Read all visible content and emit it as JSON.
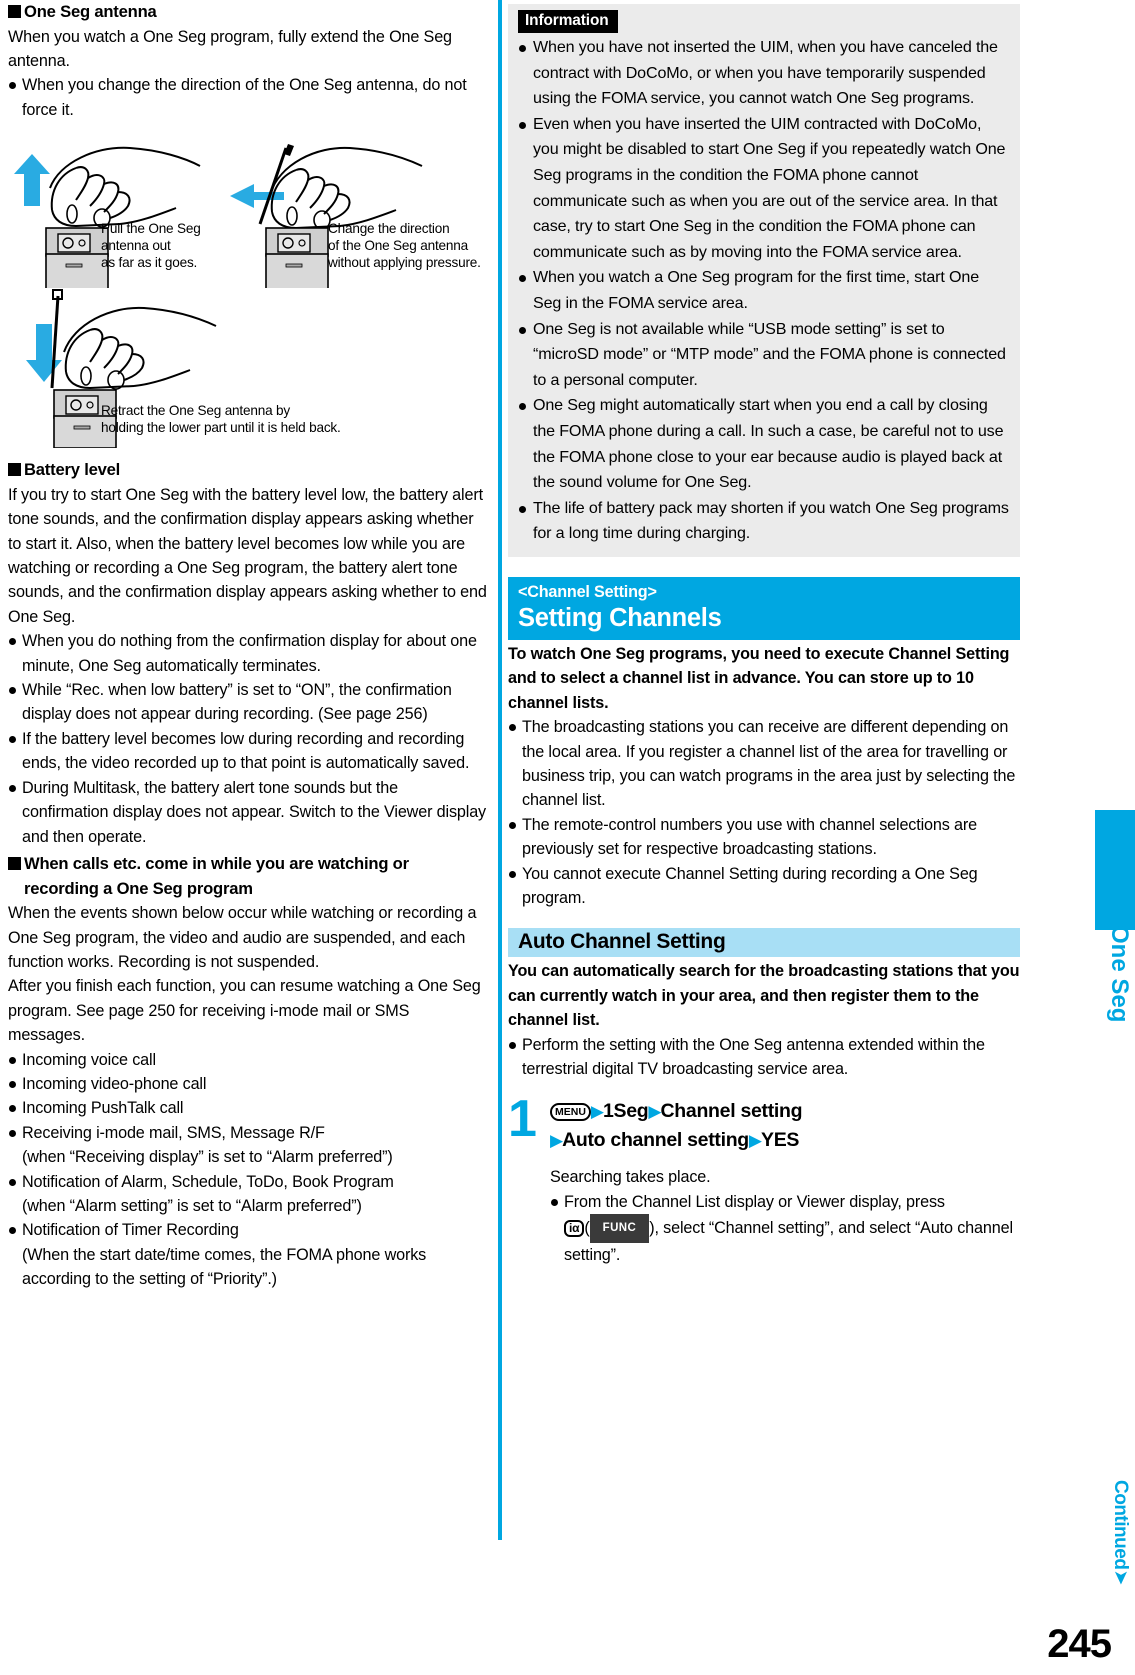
{
  "page": {
    "number": "245",
    "continued_label": "Continued",
    "side_tab_label": "One Seg"
  },
  "left": {
    "antenna_section": {
      "heading": "One Seg antenna",
      "paragraph": "When you watch a One Seg program, fully extend the One Seg antenna.",
      "bullets": [
        "When you change the direction of the One Seg antenna, do not force it."
      ],
      "figures": [
        {
          "name": "pull-antenna-figure",
          "caption": "Pull the One Seg\nantenna out\nas far as it goes.",
          "arrow": "up"
        },
        {
          "name": "change-direction-figure",
          "caption": "Change the direction\nof the One Seg antenna\nwithout applying pressure.",
          "arrow": "left"
        },
        {
          "name": "retract-antenna-figure",
          "caption": "Retract the One Seg antenna by\nholding the lower part until it is held back.",
          "arrow": "down"
        }
      ]
    },
    "battery_section": {
      "heading": "Battery level",
      "paragraph": "If you try to start One Seg with the battery level low, the battery alert tone sounds, and the confirmation display appears asking whether to start it. Also, when the battery level becomes low while you are watching or recording a One Seg program, the battery alert tone sounds, and the confirmation display appears asking whether to end One Seg.",
      "bullets": [
        "When you do nothing from the confirmation display for about one minute, One Seg automatically terminates.",
        "While “Rec. when low battery” is set to “ON”, the confirmation display does not appear during recording. (See page 256)",
        "If the battery level becomes low during recording and recording ends, the video recorded up to that point is automatically saved.",
        "During Multitask, the battery alert tone sounds but the confirmation display does not appear. Switch to the Viewer display and then operate."
      ]
    },
    "calls_section": {
      "heading_line1": "When calls etc. come in while you are watching or",
      "heading_line2": "recording a One Seg program",
      "paragraph1": "When the events shown below occur while watching or recording a One Seg program, the video and audio are suspended, and each function works. Recording is not suspended.",
      "paragraph2": "After you finish each function, you can resume watching a One Seg program. See page 250 for receiving i-mode mail or SMS messages.",
      "bullets": [
        "Incoming voice call",
        "Incoming video-phone call",
        "Incoming PushTalk call",
        "Receiving i-mode mail, SMS, Message R/F",
        "Notification of Alarm, Schedule, ToDo, Book Program",
        "Notification of Timer Recording"
      ],
      "sub_lines": {
        "after_receiving": "(when “Receiving display” is set to “Alarm preferred”)",
        "after_notification_alarm": "(when “Alarm setting” is set to “Alarm preferred”)",
        "after_timer_1": "(When the start date/time comes, the FOMA phone works",
        "after_timer_2": "according to the setting of “Priority”.)"
      }
    }
  },
  "right": {
    "information": {
      "tag": "Information",
      "bullets": [
        "When you have not inserted the UIM, when you have canceled the contract with DoCoMo, or when you have temporarily suspended using the FOMA service, you cannot watch One Seg programs.",
        "Even when you have inserted the UIM contracted with DoCoMo, you might be disabled to start One Seg if you repeatedly watch One Seg programs in the condition the FOMA phone cannot communicate such as when you are out of the service area. In that case, try to start One Seg in the condition the FOMA phone can communicate such as by moving into the FOMA service area.",
        "When you watch a One Seg program for the first time, start One Seg in the FOMA service area.",
        "One Seg is not available while “USB mode setting” is set to “microSD mode” or “MTP mode” and the FOMA phone is connected to a personal computer.",
        "One Seg might automatically start when you end a call by closing the FOMA phone during a call. In such a case, be careful not to use the FOMA phone close to your ear because audio is played back at the sound volume for One Seg.",
        "The life of battery pack may shorten if you watch One Seg programs for a long time during charging."
      ]
    },
    "channel_setting": {
      "eyebrow": "<Channel Setting>",
      "title": "Setting Channels",
      "lead": "To watch One Seg programs, you need to execute Channel Setting and to select a channel list in advance. You can store up to 10 channel lists.",
      "bullets": [
        "The broadcasting stations you can receive are different depending on the local area. If you register a channel list of the area for travelling or business trip, you can watch programs in the area just by selecting the channel list.",
        "The remote-control numbers you use with channel selections are previously set for respective broadcasting stations.",
        "You cannot execute Channel Setting during recording a One Seg program."
      ]
    },
    "auto_channel": {
      "subheading": "Auto Channel Setting",
      "lead": "You can automatically search for the broadcasting stations that you can currently watch in your area, and then register them to the channel list.",
      "bullets": [
        "Perform the setting with the One Seg antenna extended within the terrestrial digital TV broadcasting service area."
      ],
      "step": {
        "number": "1",
        "key_label": "MENU",
        "seq_1": "1Seg",
        "seq_2": "Channel setting",
        "seq_3": "Auto channel setting",
        "seq_4": "YES",
        "arrow_glyph": "▶",
        "result": "Searching takes place.",
        "note_part1": "From the Channel List display or Viewer display, press",
        "note_icon": "iα",
        "note_open_paren": "(",
        "note_func": "FUNC",
        "note_part2": "), select “Channel setting”, and select “Auto channel setting”."
      }
    }
  },
  "colors": {
    "accent": "#00A7E1",
    "subhead_bg": "#A8DFF5",
    "info_bg": "#ebebeb",
    "func_bg": "#3a3a3a"
  }
}
